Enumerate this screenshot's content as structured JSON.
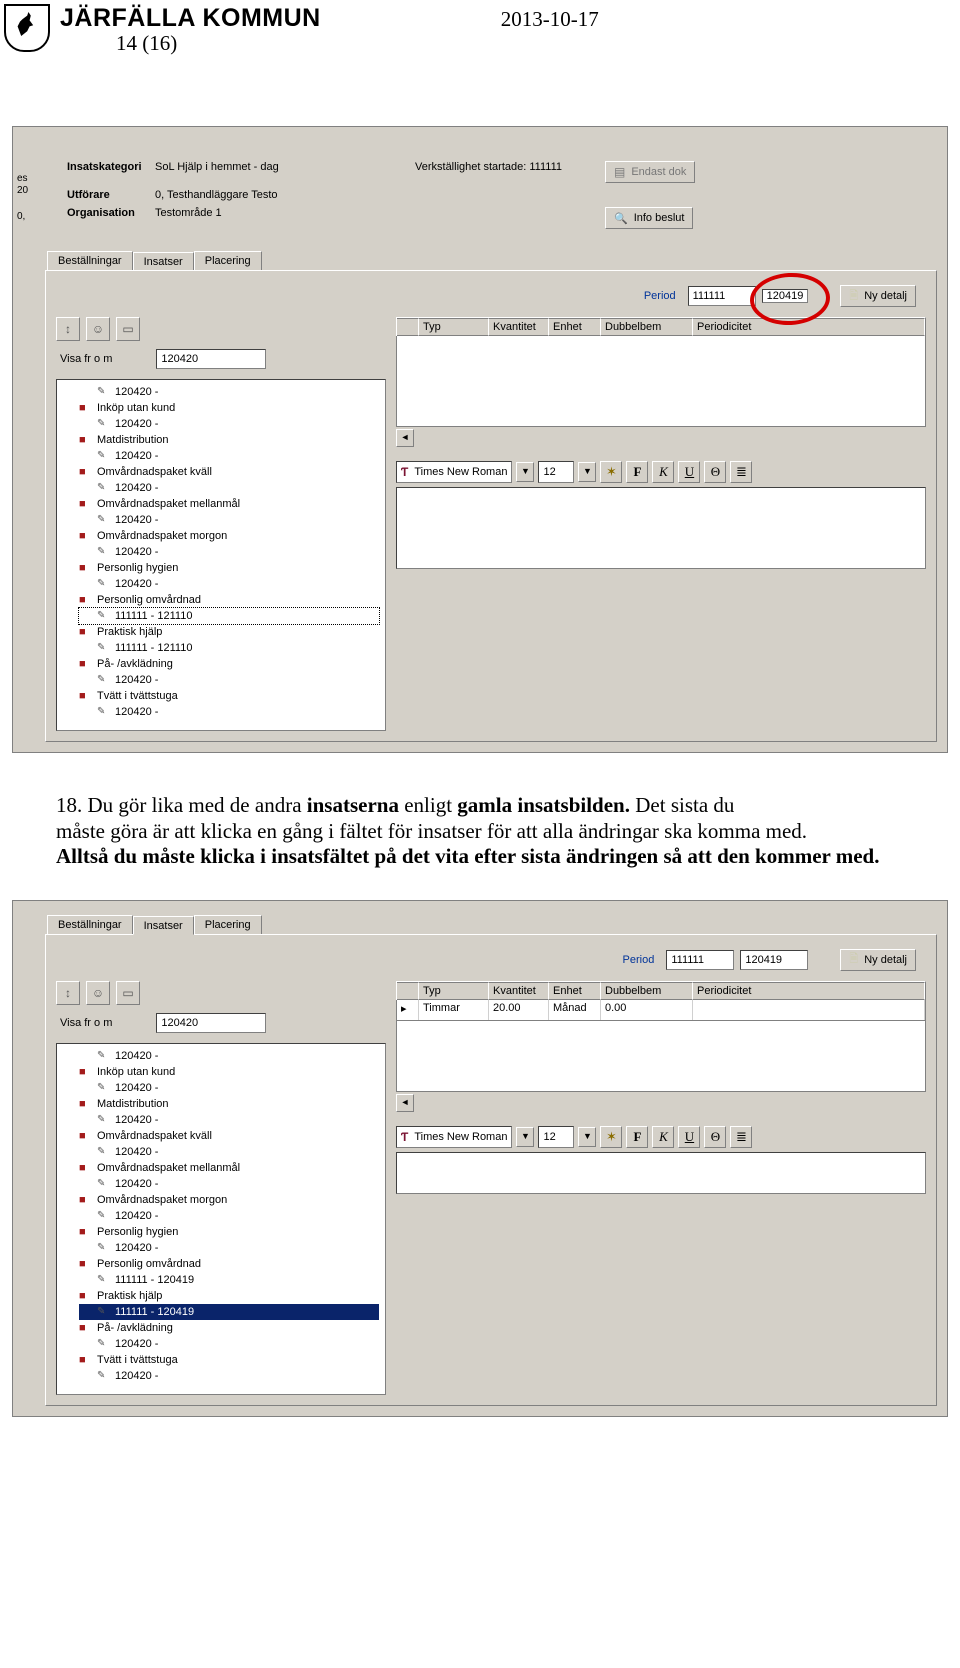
{
  "doc": {
    "org": "JÄRFÄLLA KOMMUN",
    "page": "14 (16)",
    "date": "2013-10-17"
  },
  "paragraph": {
    "num": "18.",
    "l1a": "Du gör lika med de andra ",
    "l1b": "insatserna",
    "l1c": " enligt ",
    "l1d": "gamla insatsbilden.",
    "l1e": " Det sista du",
    "l2": "måste göra är att klicka en gång i fältet för insatser för att alla ändringar ska komma med.",
    "l3": "Alltså du måste klicka i insatsfältet på det vita efter sista ändringen så att den kommer med."
  },
  "win": {
    "labels": {
      "insatskategori": "Insatskategori",
      "utforare": "Utförare",
      "organisation": "Organisation",
      "verk": "Verkställighet startade:",
      "endast": "Endast dok",
      "infobeslut": "Info beslut",
      "bestallningar": "Beställningar",
      "insatser": "Insatser",
      "placering": "Placering",
      "period": "Period",
      "nydetalj": "Ny detalj",
      "typ": "Typ",
      "kvantitet": "Kvantitet",
      "enhet": "Enhet",
      "dubbelbem": "Dubbelbem",
      "periodicitet": "Periodicitet",
      "visafrom": "Visa fr o m",
      "font": "Times New Roman",
      "fontsize": "12"
    },
    "values": {
      "insatskategori": "SoL Hjälp i hemmet - dag",
      "utforare": "0, Testhandläggare Testo",
      "organisation": "Testområde 1",
      "verk": "111111",
      "period_from": "111111",
      "visa": "120420"
    },
    "fmt_btns": [
      "F",
      "K",
      "U",
      "Θ",
      "≣"
    ]
  },
  "shot1": {
    "period_to": "120419",
    "gutter": {
      "g1": "es",
      "g2": "20",
      "g3": "0,"
    },
    "tree": [
      {
        "t": "node",
        "label": "120420 -",
        "sel": false
      },
      {
        "t": "folder",
        "label": "Inköp utan kund"
      },
      {
        "t": "node",
        "label": "120420 -"
      },
      {
        "t": "folder",
        "label": "Matdistribution"
      },
      {
        "t": "node",
        "label": "120420 -"
      },
      {
        "t": "folder",
        "label": "Omvårdnadspaket kväll"
      },
      {
        "t": "node",
        "label": "120420 -"
      },
      {
        "t": "folder",
        "label": "Omvårdnadspaket mellanmål"
      },
      {
        "t": "node",
        "label": "120420 -"
      },
      {
        "t": "folder",
        "label": "Omvårdnadspaket morgon"
      },
      {
        "t": "node",
        "label": "120420 -"
      },
      {
        "t": "folder",
        "label": "Personlig hygien"
      },
      {
        "t": "node",
        "label": "120420 -"
      },
      {
        "t": "folder",
        "label": "Personlig omvårdnad"
      },
      {
        "t": "node",
        "label": "111111 - 121110",
        "sel": "box"
      },
      {
        "t": "folder",
        "label": "Praktisk hjälp"
      },
      {
        "t": "node",
        "label": "111111 - 121110"
      },
      {
        "t": "folder",
        "label": "På- /avklädning"
      },
      {
        "t": "node",
        "label": "120420 -"
      },
      {
        "t": "folder",
        "label": "Tvätt i tvättstuga"
      },
      {
        "t": "node",
        "label": "120420 -"
      }
    ],
    "gridrow": null
  },
  "shot2": {
    "period_to": "120419",
    "tree": [
      {
        "t": "node",
        "label": "120420 -"
      },
      {
        "t": "folder",
        "label": "Inköp utan kund"
      },
      {
        "t": "node",
        "label": "120420 -"
      },
      {
        "t": "folder",
        "label": "Matdistribution"
      },
      {
        "t": "node",
        "label": "120420 -"
      },
      {
        "t": "folder",
        "label": "Omvårdnadspaket kväll"
      },
      {
        "t": "node",
        "label": "120420 -"
      },
      {
        "t": "folder",
        "label": "Omvårdnadspaket mellanmål"
      },
      {
        "t": "node",
        "label": "120420 -"
      },
      {
        "t": "folder",
        "label": "Omvårdnadspaket morgon"
      },
      {
        "t": "node",
        "label": "120420 -"
      },
      {
        "t": "folder",
        "label": "Personlig hygien"
      },
      {
        "t": "node",
        "label": "120420 -"
      },
      {
        "t": "folder",
        "label": "Personlig omvårdnad"
      },
      {
        "t": "node",
        "label": "111111 - 120419"
      },
      {
        "t": "folder",
        "label": "Praktisk hjälp"
      },
      {
        "t": "node",
        "label": "111111 - 120419",
        "sel": true
      },
      {
        "t": "folder",
        "label": "På- /avklädning"
      },
      {
        "t": "node",
        "label": "120420 -"
      },
      {
        "t": "folder",
        "label": "Tvätt i tvättstuga"
      },
      {
        "t": "node",
        "label": "120420 -"
      }
    ],
    "gridrow": {
      "typ": "Timmar",
      "kvantitet": "20.00",
      "enhet": "Månad",
      "dubbelbem": "0.00",
      "periodicitet": ""
    }
  }
}
